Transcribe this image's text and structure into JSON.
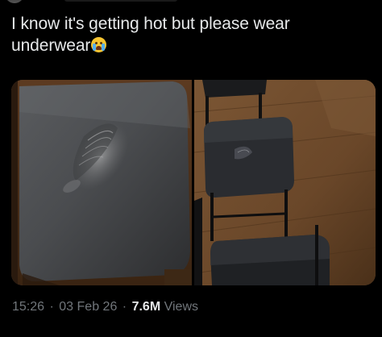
{
  "tweet": {
    "text_line1": "I know it's getting hot but please wear",
    "text_line2": "underwear",
    "emoji": "loudly-crying-face",
    "media": [
      {
        "subject": "folding-chair-seat-closeup"
      },
      {
        "subject": "folding-chairs-on-wood-floor"
      }
    ]
  },
  "meta": {
    "time": "15:26",
    "separator": "·",
    "date": "03 Feb 26",
    "views_count": "7.6M",
    "views_label": "Views"
  },
  "colors": {
    "background": "#000000",
    "text_primary": "#e7e9ea",
    "text_secondary": "#71767b"
  }
}
